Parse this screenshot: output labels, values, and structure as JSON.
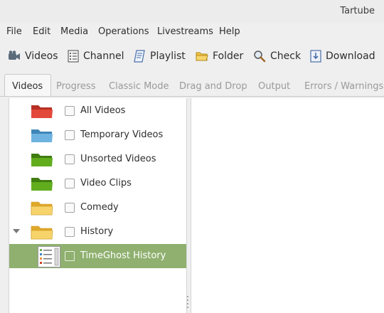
{
  "window": {
    "title": "Tartube"
  },
  "menu": [
    "File",
    "Edit",
    "Media",
    "Operations",
    "Livestreams",
    "Help"
  ],
  "toolbar": [
    {
      "label": "Videos",
      "icon": "videos-icon"
    },
    {
      "label": "Channel",
      "icon": "channel-icon"
    },
    {
      "label": "Playlist",
      "icon": "playlist-icon"
    },
    {
      "label": "Folder",
      "icon": "folder-icon"
    },
    {
      "label": "Check",
      "icon": "check-icon"
    },
    {
      "label": "Download",
      "icon": "download-icon"
    }
  ],
  "tabs": [
    "Videos",
    "Progress",
    "Classic Mode",
    "Drag and Drop",
    "Output",
    "Errors / Warnings"
  ],
  "active_tab": "Videos",
  "tree": [
    {
      "label": "All Videos",
      "icon": "folder-icon-red",
      "color": "#e2493b",
      "checked": false
    },
    {
      "label": "Temporary Videos",
      "icon": "folder-icon-blue",
      "color": "#5fa7d8",
      "checked": false
    },
    {
      "label": "Unsorted Videos",
      "icon": "folder-icon-green",
      "color": "#5aa31c",
      "checked": false
    },
    {
      "label": "Video Clips",
      "icon": "folder-icon-green",
      "color": "#5aa31c",
      "checked": false
    },
    {
      "label": "Comedy",
      "icon": "folder-icon-yellow",
      "color": "#f2c447",
      "checked": false
    },
    {
      "label": "History",
      "icon": "folder-icon-yellow",
      "color": "#f2c447",
      "checked": false,
      "expanded": true
    },
    {
      "label": "TimeGhost History",
      "icon": "channel-thumbnail",
      "checked": false,
      "selected": true
    }
  ],
  "colors": {
    "selection": "#8fb06f"
  }
}
